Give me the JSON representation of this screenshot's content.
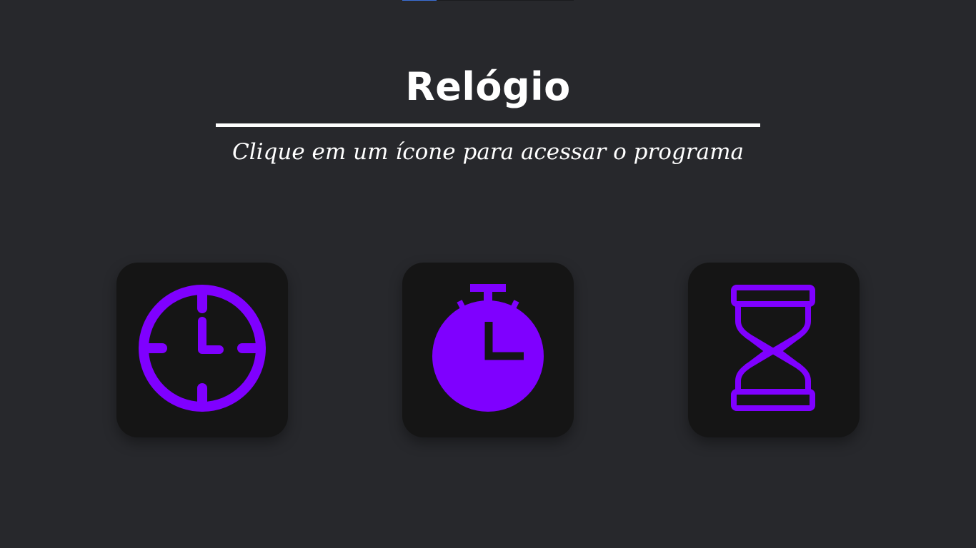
{
  "header": {
    "title": "Relógio",
    "subtitle": "Clique em um ícone para acessar o programa"
  },
  "tiles": [
    {
      "id": "clock",
      "icon": "clock-icon"
    },
    {
      "id": "stopwatch",
      "icon": "stopwatch-icon"
    },
    {
      "id": "timer",
      "icon": "hourglass-icon"
    }
  ],
  "colors": {
    "background": "#27282c",
    "tile": "#151515",
    "accent": "#7f00ff",
    "text": "#ffffff"
  }
}
